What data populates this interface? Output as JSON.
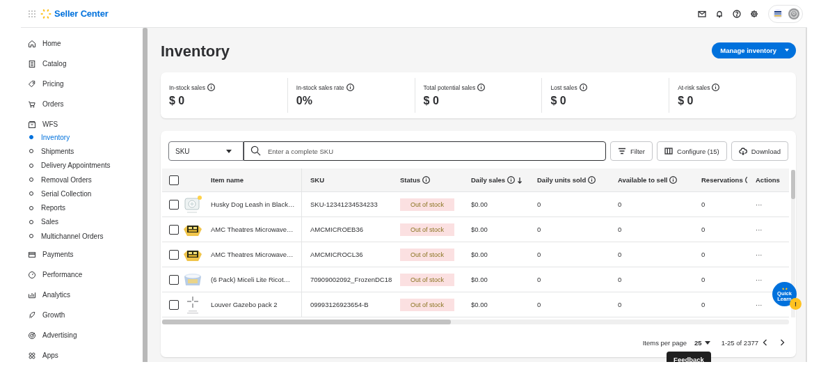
{
  "app": {
    "title": "Seller Center"
  },
  "sidebar": {
    "items": [
      {
        "label": "Home",
        "selected": false
      },
      {
        "label": "Catalog",
        "selected": false
      },
      {
        "label": "Pricing",
        "selected": false
      },
      {
        "label": "Orders",
        "selected": false
      },
      {
        "label": "WFS",
        "selected": false,
        "expanded": true,
        "children": [
          {
            "label": "Inventory",
            "selected": true
          },
          {
            "label": "Shipments",
            "selected": false
          },
          {
            "label": "Delivery Appointments",
            "selected": false
          },
          {
            "label": "Removal Orders",
            "selected": false
          },
          {
            "label": "Serial Collection",
            "selected": false
          },
          {
            "label": "Reports",
            "selected": false
          },
          {
            "label": "Sales",
            "selected": false
          },
          {
            "label": "Multichannel Orders",
            "selected": false
          }
        ]
      },
      {
        "label": "Payments",
        "selected": false
      },
      {
        "label": "Performance",
        "selected": false
      },
      {
        "label": "Analytics",
        "selected": false
      },
      {
        "label": "Growth",
        "selected": false
      },
      {
        "label": "Advertising",
        "selected": false
      },
      {
        "label": "Apps",
        "selected": false
      }
    ]
  },
  "page": {
    "title": "Inventory",
    "primary_action": "Manage inventory"
  },
  "stats": [
    {
      "label": "In-stock sales",
      "value": "$ 0"
    },
    {
      "label": "In-stock sales rate",
      "value": "0%"
    },
    {
      "label": "Total potential sales",
      "value": "$ 0"
    },
    {
      "label": "Lost sales",
      "value": "$ 0"
    },
    {
      "label": "At-risk sales",
      "value": "$ 0"
    }
  ],
  "toolbar": {
    "search_by": "SKU",
    "search_placeholder": "Enter a complete SKU",
    "buttons": [
      "Filter",
      "Configure (15)",
      "Download"
    ]
  },
  "table": {
    "select_all_checked": false,
    "columns": [
      {
        "label": "Item name",
        "info": false
      },
      {
        "label": "SKU",
        "info": false
      },
      {
        "label": "Status",
        "info": true
      },
      {
        "label": "Daily sales",
        "info": true,
        "sorted_descending": true
      },
      {
        "label": "Daily units sold",
        "info": true
      },
      {
        "label": "Available to sell",
        "info": true
      },
      {
        "label": "Reservations",
        "info": true
      },
      {
        "label": "Actions",
        "info": false
      }
    ],
    "rows": [
      {
        "checked": false,
        "item_name": "Husky Dog Leash in Black…",
        "sku": "SKU-12341234534233",
        "status": "Out of stock",
        "daily_sales": "$0.00",
        "daily_units_sold": "0",
        "available_to_sell": "0",
        "reservations": "0",
        "actions": "···"
      },
      {
        "checked": false,
        "item_name": "AMC Theatres Microwave…",
        "sku": "AMCMICROEB36",
        "status": "Out of stock",
        "daily_sales": "$0.00",
        "daily_units_sold": "0",
        "available_to_sell": "0",
        "reservations": "0",
        "actions": "···"
      },
      {
        "checked": false,
        "item_name": "AMC Theatres Microwave…",
        "sku": "AMCMICROCL36",
        "status": "Out of stock",
        "daily_sales": "$0.00",
        "daily_units_sold": "0",
        "available_to_sell": "0",
        "reservations": "0",
        "actions": "···"
      },
      {
        "checked": false,
        "item_name": "(6 Pack) Miceli Lite Ricot…",
        "sku": "70909002092_FrozenDC18",
        "status": "Out of stock",
        "daily_sales": "$0.00",
        "daily_units_sold": "0",
        "available_to_sell": "0",
        "reservations": "0",
        "actions": "···"
      },
      {
        "checked": false,
        "item_name": "Louver Gazebo pack 2",
        "sku": "09993126923654-B",
        "status": "Out of stock",
        "daily_sales": "$0.00",
        "daily_units_sold": "0",
        "available_to_sell": "0",
        "reservations": "0",
        "actions": "···"
      }
    ]
  },
  "pagination": {
    "items_per_page_label": "Items per page",
    "items_per_page": "25",
    "range": "1-25 of 2377"
  },
  "quick_learn": {
    "label": "Quick Learn",
    "badge": "!"
  },
  "feedback": "Feedback"
}
